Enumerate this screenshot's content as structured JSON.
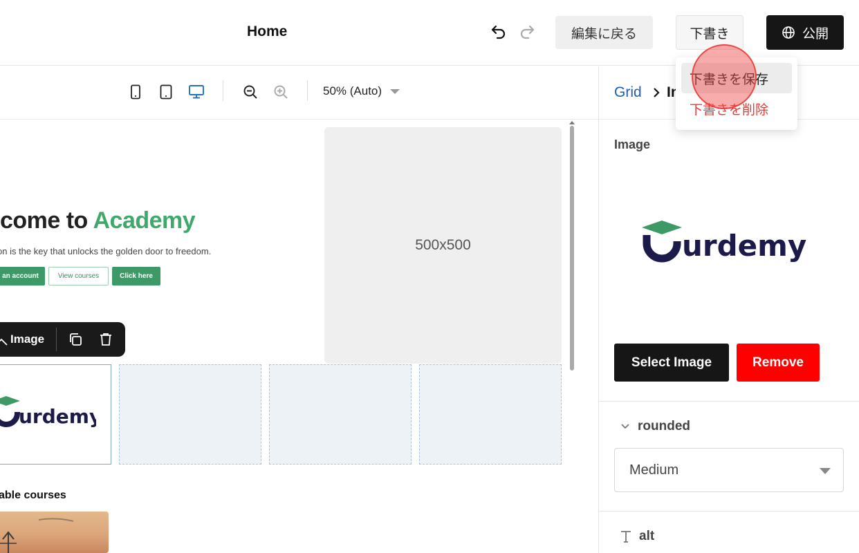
{
  "topbar": {
    "page_title": "Home",
    "undo_icon": "undo-icon",
    "redo_icon": "redo-icon",
    "back_to_edit_label": "編集に戻る",
    "draft_label": "下書き",
    "publish_label": "公開",
    "publish_icon": "globe-icon"
  },
  "draft_menu": {
    "items": [
      {
        "label": "下書きを保存",
        "color": "#222222"
      },
      {
        "label": "下書きを削除",
        "color": "#e53935"
      }
    ]
  },
  "canvas_toolbar": {
    "devices": [
      "mobile-icon",
      "tablet-icon",
      "desktop-icon"
    ],
    "active_device": "desktop",
    "zoom_label": "50% (Auto)"
  },
  "canvas": {
    "hero": {
      "title_prefix": "lcome to ",
      "title_accent": "Academy",
      "subtitle": "on is the key that unlocks the golden door to freedom.",
      "buttons": [
        "an account",
        "View courses",
        "Click here"
      ]
    },
    "placeholder_label": "500x500",
    "element_toolbar": {
      "label": "Image",
      "icons": [
        "image-icon",
        "duplicate-icon",
        "trash-icon"
      ]
    },
    "grid_logo_text": "urdemy",
    "courses_title": "able courses"
  },
  "panel": {
    "breadcrumb": {
      "parent": "Grid",
      "current": "In"
    },
    "image_section_label": "Image",
    "logo_text": "urdemy",
    "select_image_label": "Select Image",
    "remove_label": "Remove",
    "rounded": {
      "label": "rounded",
      "value": "Medium"
    },
    "alt": {
      "label": "alt"
    }
  },
  "colors": {
    "accent_green": "#3fa86b",
    "logo_navy": "#1c1a4a",
    "logo_cap_green": "#3d9a66",
    "remove_red": "#ff0000",
    "link_blue": "#1f5ea8"
  }
}
